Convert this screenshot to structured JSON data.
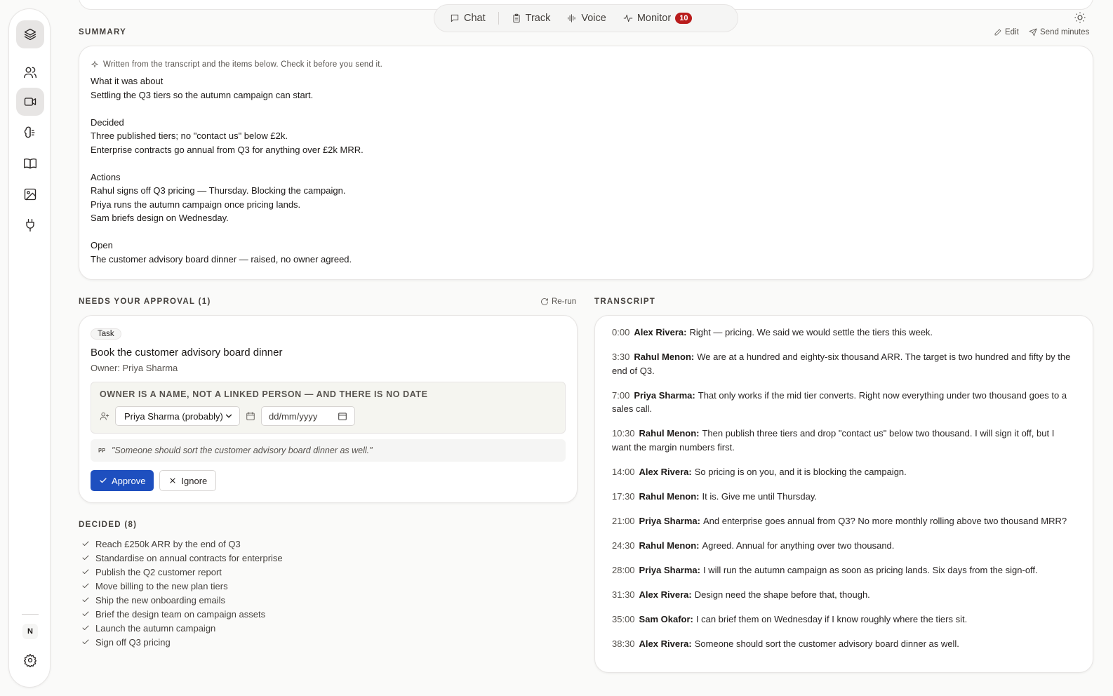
{
  "rail": {
    "items": [
      {
        "icon": "layers-icon",
        "active": true
      },
      {
        "icon": "users-icon",
        "active": false
      },
      {
        "icon": "video-icon",
        "active": true
      },
      {
        "icon": "brain-icon",
        "active": false
      },
      {
        "icon": "book-icon",
        "active": false
      },
      {
        "icon": "image-icon",
        "active": false
      },
      {
        "icon": "plug-icon",
        "active": false
      }
    ],
    "avatar_initial": "N",
    "settings_icon": "gear-icon"
  },
  "topnav": {
    "chat_label": "Chat",
    "track_label": "Track",
    "voice_label": "Voice",
    "monitor_label": "Monitor",
    "monitor_count": "10"
  },
  "summary": {
    "heading": "SUMMARY",
    "edit_label": "Edit",
    "send_label": "Send minutes",
    "note": "Written from the transcript and the items below. Check it before you send it.",
    "lines": [
      "What it was about",
      "Settling the Q3 tiers so the autumn campaign can start.",
      "",
      "Decided",
      "Three published tiers; no \"contact us\" below £2k.",
      "Enterprise contracts go annual from Q3 for anything over £2k MRR.",
      "",
      "Actions",
      "Rahul signs off Q3 pricing — Thursday. Blocking the campaign.",
      "Priya runs the autumn campaign once pricing lands.",
      "Sam briefs design on Wednesday.",
      "",
      "Open",
      "The customer advisory board dinner — raised, no owner agreed."
    ]
  },
  "approval": {
    "heading": "NEEDS YOUR APPROVAL (1)",
    "rerun_label": "Re-run",
    "tag": "Task",
    "title": "Book the customer advisory board dinner",
    "owner": "Owner: Priya Sharma",
    "warning": "OWNER IS A NAME, NOT A LINKED PERSON — AND THERE IS NO DATE",
    "owner_select_value": "Priya Sharma (probably)",
    "date_placeholder": "dd/mm/yyyy",
    "quote": "\"Someone should sort the customer advisory board dinner as well.\"",
    "approve_label": "Approve",
    "ignore_label": "Ignore"
  },
  "decided": {
    "heading": "DECIDED (8)",
    "items": [
      "Reach £250k ARR by the end of Q3",
      "Standardise on annual contracts for enterprise",
      "Publish the Q2 customer report",
      "Move billing to the new plan tiers",
      "Ship the new onboarding emails",
      "Brief the design team on campaign assets",
      "Launch the autumn campaign",
      "Sign off Q3 pricing"
    ]
  },
  "transcript": {
    "heading": "TRANSCRIPT",
    "lines": [
      {
        "time": "0:00",
        "speaker": "Alex Rivera:",
        "text": "Right — pricing. We said we would settle the tiers this week."
      },
      {
        "time": "3:30",
        "speaker": "Rahul Menon:",
        "text": "We are at a hundred and eighty-six thousand ARR. The target is two hundred and fifty by the end of Q3."
      },
      {
        "time": "7:00",
        "speaker": "Priya Sharma:",
        "text": "That only works if the mid tier converts. Right now everything under two thousand goes to a sales call."
      },
      {
        "time": "10:30",
        "speaker": "Rahul Menon:",
        "text": "Then publish three tiers and drop \"contact us\" below two thousand. I will sign it off, but I want the margin numbers first."
      },
      {
        "time": "14:00",
        "speaker": "Alex Rivera:",
        "text": "So pricing is on you, and it is blocking the campaign."
      },
      {
        "time": "17:30",
        "speaker": "Rahul Menon:",
        "text": "It is. Give me until Thursday."
      },
      {
        "time": "21:00",
        "speaker": "Priya Sharma:",
        "text": "And enterprise goes annual from Q3? No more monthly rolling above two thousand MRR?"
      },
      {
        "time": "24:30",
        "speaker": "Rahul Menon:",
        "text": "Agreed. Annual for anything over two thousand."
      },
      {
        "time": "28:00",
        "speaker": "Priya Sharma:",
        "text": "I will run the autumn campaign as soon as pricing lands. Six days from the sign-off."
      },
      {
        "time": "31:30",
        "speaker": "Alex Rivera:",
        "text": "Design need the shape before that, though."
      },
      {
        "time": "35:00",
        "speaker": "Sam Okafor:",
        "text": "I can brief them on Wednesday if I know roughly where the tiers sit."
      },
      {
        "time": "38:30",
        "speaker": "Alex Rivera:",
        "text": "Someone should sort the customer advisory board dinner as well."
      }
    ]
  },
  "colors": {
    "accent": "#1e4fbf",
    "badge": "#b91c1c",
    "background": "#fafaf9"
  }
}
